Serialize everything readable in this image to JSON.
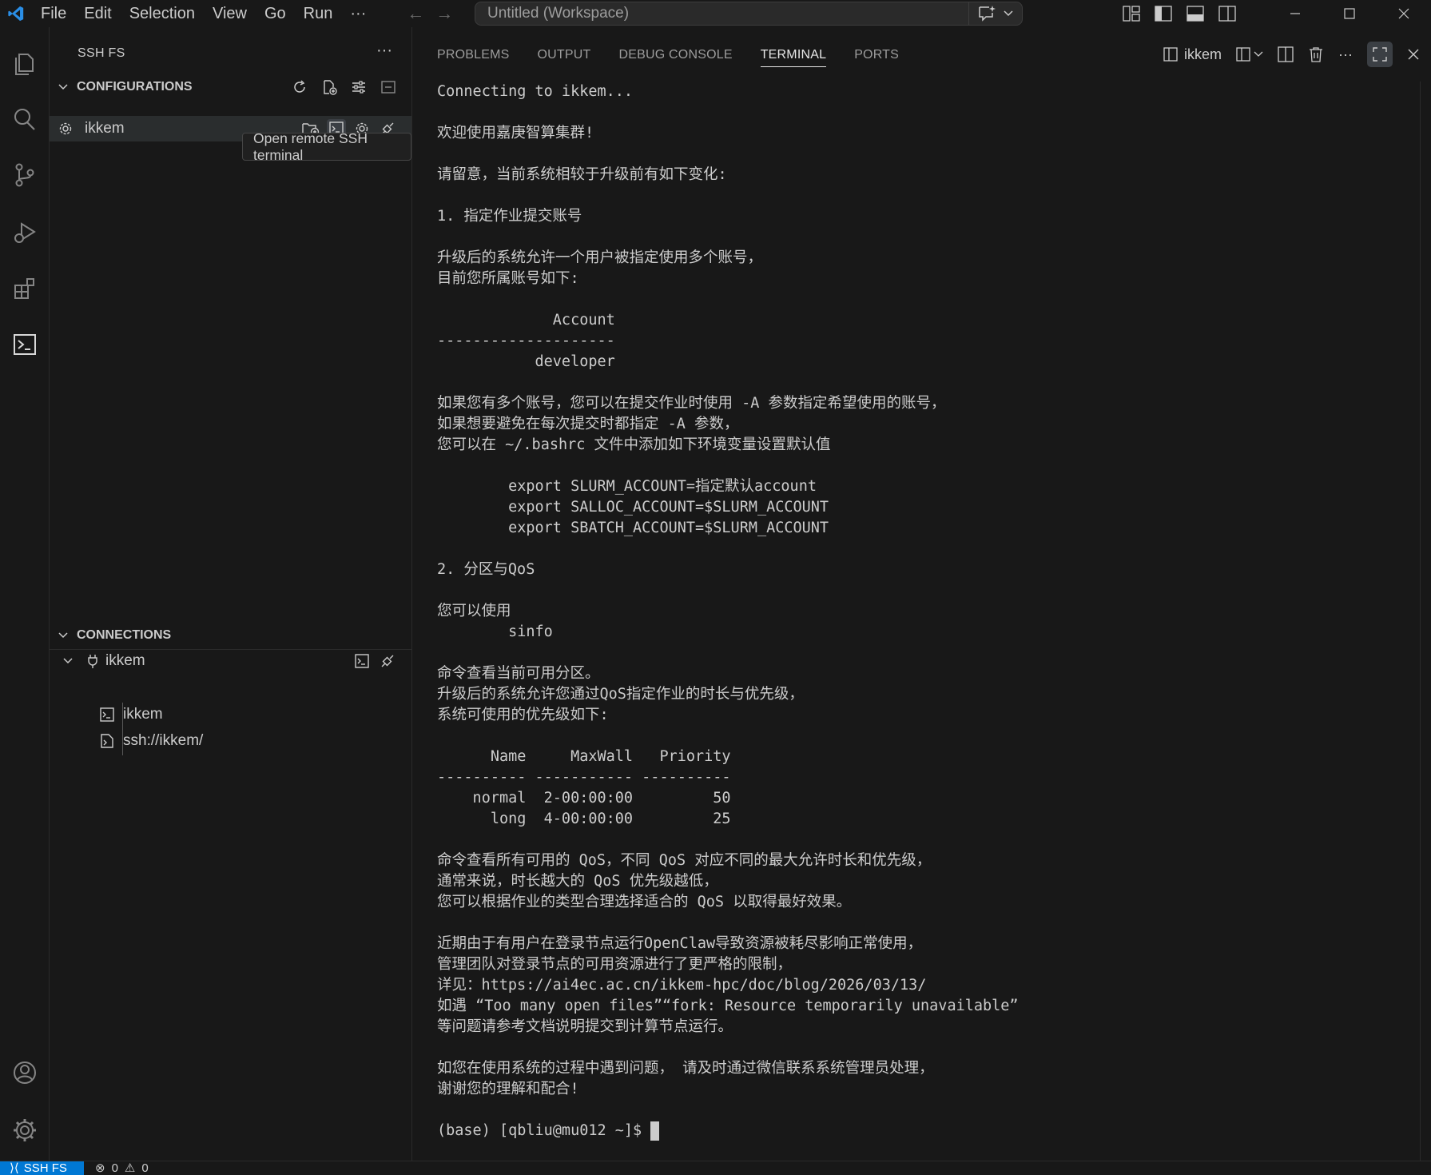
{
  "titlebar": {
    "menu": [
      "File",
      "Edit",
      "Selection",
      "View",
      "Go",
      "Run",
      "···"
    ],
    "search_text": "Untitled (Workspace)"
  },
  "sidebar": {
    "title": "SSH FS",
    "more": "···",
    "configurations": {
      "header": "CONFIGURATIONS",
      "items": [
        {
          "label": "ikkem"
        }
      ]
    },
    "tooltip": "Open remote SSH terminal",
    "connections": {
      "header": "CONNECTIONS",
      "items": [
        {
          "label": "ikkem"
        },
        {
          "label": "ikkem"
        },
        {
          "label": "ssh://ikkem/"
        }
      ]
    }
  },
  "panel": {
    "tabs": [
      {
        "label": "PROBLEMS"
      },
      {
        "label": "OUTPUT"
      },
      {
        "label": "DEBUG CONSOLE"
      },
      {
        "label": "TERMINAL"
      },
      {
        "label": "PORTS"
      }
    ],
    "active_tab": "TERMINAL",
    "terminal_name": "ikkem"
  },
  "terminal": {
    "lines": [
      "Connecting to ikkem...",
      "",
      "欢迎使用嘉庚智算集群!",
      "",
      "请留意，当前系统相较于升级前有如下变化:",
      "",
      "1. 指定作业提交账号",
      "",
      "升级后的系统允许一个用户被指定使用多个账号，",
      "目前您所属账号如下:",
      "",
      "             Account",
      "--------------------",
      "           developer",
      "",
      "如果您有多个账号，您可以在提交作业时使用 -A 参数指定希望使用的账号，",
      "如果想要避免在每次提交时都指定 -A 参数，",
      "您可以在 ~/.bashrc 文件中添加如下环境变量设置默认值",
      "",
      "        export SLURM_ACCOUNT=指定默认account",
      "        export SALLOC_ACCOUNT=$SLURM_ACCOUNT",
      "        export SBATCH_ACCOUNT=$SLURM_ACCOUNT",
      "",
      "2. 分区与QoS",
      "",
      "您可以使用",
      "        sinfo",
      "",
      "命令查看当前可用分区。",
      "升级后的系统允许您通过QoS指定作业的时长与优先级，",
      "系统可使用的优先级如下:",
      "",
      "      Name     MaxWall   Priority",
      "---------- ----------- ----------",
      "    normal  2-00:00:00         50",
      "      long  4-00:00:00         25",
      "",
      "命令查看所有可用的 QoS，不同 QoS 对应不同的最大允许时长和优先级，",
      "通常来说，时长越大的 QoS 优先级越低，",
      "您可以根据作业的类型合理选择适合的 QoS 以取得最好效果。",
      "",
      "近期由于有用户在登录节点运行OpenClaw导致资源被耗尽影响正常使用，",
      "管理团队对登录节点的可用资源进行了更严格的限制，",
      "详见：https://ai4ec.ac.cn/ikkem-hpc/doc/blog/2026/03/13/",
      "如遇 “Too many open files”“fork: Resource temporarily unavailable”",
      "等问题请参考文档说明提交到计算节点运行。",
      "",
      "如您在使用系统的过程中遇到问题， 请及时通过微信联系系统管理员处理，",
      "谢谢您的理解和配合!",
      ""
    ],
    "prompt": "(base) [qbliu@mu012 ~]$ "
  },
  "statusbar": {
    "remote": "SSH FS",
    "errors": "0",
    "warnings": "0"
  },
  "colors": {
    "accent": "#0078d4",
    "background": "#181818",
    "text": "#cccccc"
  }
}
